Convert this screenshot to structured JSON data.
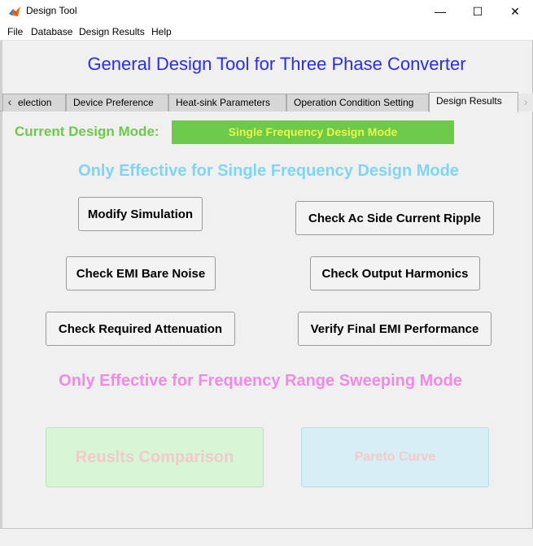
{
  "window": {
    "title": "Design Tool",
    "icon": "matlab-icon",
    "controls": {
      "minimize": "—",
      "maximize": "☐",
      "close": "✕"
    }
  },
  "menu": [
    "File",
    "Database",
    "Design Results",
    "Help"
  ],
  "header": {
    "title": "General Design Tool for Three Phase Converter"
  },
  "tabs": [
    {
      "label": "election",
      "active": false
    },
    {
      "label": "Device Preference",
      "active": false
    },
    {
      "label": "Heat-sink Parameters",
      "active": false
    },
    {
      "label": "Operation Condition Setting",
      "active": false
    },
    {
      "label": "Design Results",
      "active": true
    }
  ],
  "tab_scroll": {
    "left": "‹",
    "right": "›"
  },
  "mode": {
    "label": "Current Design Mode:",
    "value": "Single Frequency Design Mode",
    "color": "#6cc94a"
  },
  "single_section": {
    "heading": "Only Effective for Single Frequency Design Mode",
    "buttons": {
      "modify_simulation": "Modify Simulation",
      "check_ac_ripple": "Check Ac Side Current Ripple",
      "check_emi_noise": "Check EMI Bare Noise",
      "check_harmonics": "Check Output Harmonics",
      "check_attenuation": "Check Required Attenuation",
      "verify_emi": "Verify Final EMI Performance"
    }
  },
  "range_section": {
    "heading": "Only Effective for Frequency Range Sweeping Mode",
    "buttons": {
      "results_comparison": "Reuslts Comparison",
      "pareto_curve": "Pareto Curve"
    }
  }
}
